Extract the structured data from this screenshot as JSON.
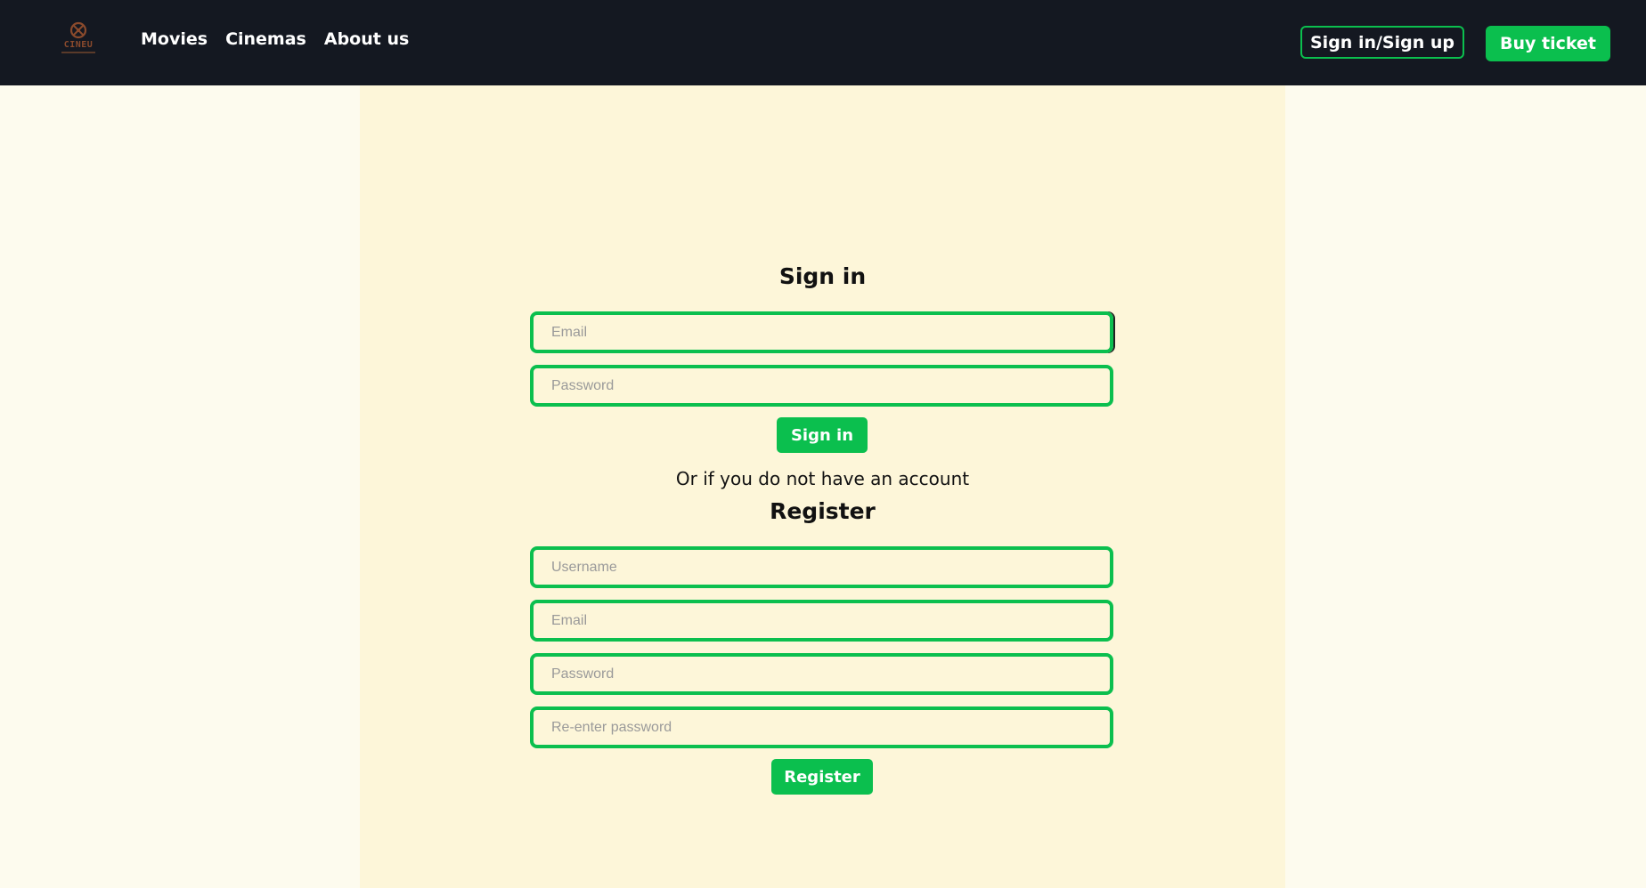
{
  "brand": {
    "logo_text": "CINEU"
  },
  "nav": {
    "items": [
      "Movies",
      "Cinemas",
      "About us"
    ]
  },
  "header_actions": {
    "signin_signup": "Sign in/Sign up",
    "buy_ticket": "Buy ticket"
  },
  "signin": {
    "title": "Sign in",
    "email_placeholder": "Email",
    "password_placeholder": "Password",
    "submit_label": "Sign in"
  },
  "separator_text": "Or if you do not have an account",
  "register": {
    "title": "Register",
    "username_placeholder": "Username",
    "email_placeholder": "Email",
    "password_placeholder": "Password",
    "reenter_placeholder": "Re-enter password",
    "submit_label": "Register"
  },
  "colors": {
    "accent": "#0bbf4e",
    "header_bg": "#141821",
    "page_bg": "#fdfbee",
    "panel_bg": "#fdf6d9"
  }
}
